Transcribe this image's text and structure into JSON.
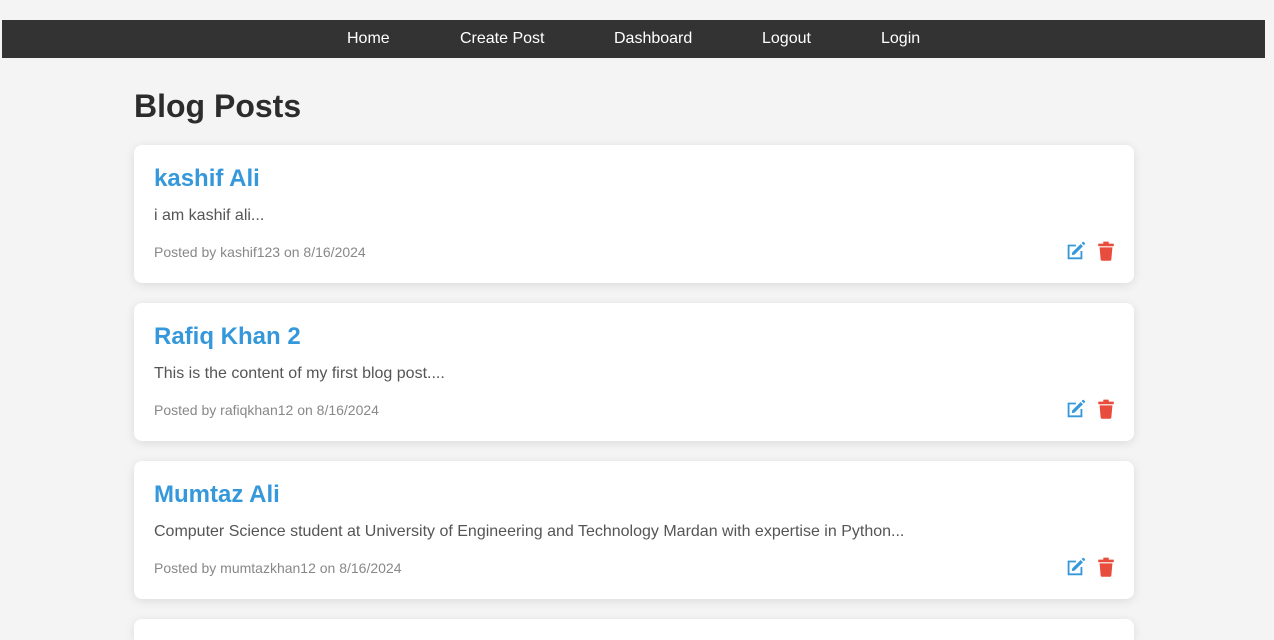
{
  "nav": {
    "items": [
      {
        "label": "Home"
      },
      {
        "label": "Create Post"
      },
      {
        "label": "Dashboard"
      },
      {
        "label": "Logout"
      },
      {
        "label": "Login"
      }
    ]
  },
  "page": {
    "title": "Blog Posts"
  },
  "colors": {
    "navbar": "#333333",
    "post_title": "#3498db",
    "edit_icon": "#3498db",
    "delete_icon": "#e74c3c",
    "background": "#f4f4f4"
  },
  "icons": {
    "edit": "edit-icon",
    "delete": "trash-icon"
  },
  "posts": [
    {
      "title": "kashif Ali",
      "excerpt": "i am kashif ali...",
      "meta": "Posted by kashif123 on 8/16/2024"
    },
    {
      "title": "Rafiq Khan 2",
      "excerpt": "This is the content of my first blog post....",
      "meta": "Posted by rafiqkhan12 on 8/16/2024"
    },
    {
      "title": "Mumtaz Ali",
      "excerpt": "Computer Science student at University of Engineering and Technology Mardan with expertise in Python...",
      "meta": "Posted by mumtazkhan12 on 8/16/2024"
    }
  ]
}
